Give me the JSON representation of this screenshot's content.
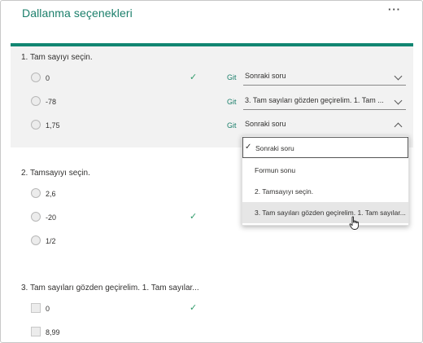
{
  "header": {
    "title": "Dallanma seçenekleri",
    "more": "···"
  },
  "git_label": "Git",
  "questions": [
    {
      "label": "1. Tam sayıyı seçin.",
      "options": [
        {
          "text": "0",
          "correct": true,
          "branch": "Sonraki soru"
        },
        {
          "text": "-78",
          "correct": false,
          "branch": "3. Tam sayıları gözden geçirelim. 1. Tam ..."
        },
        {
          "text": "1,75",
          "correct": false,
          "branch": "Sonraki soru"
        }
      ]
    },
    {
      "label": "2. Tamsayıyı seçin.",
      "options": [
        {
          "text": "2,6",
          "correct": false
        },
        {
          "text": "-20",
          "correct": true
        },
        {
          "text": "1/2",
          "correct": false
        }
      ]
    },
    {
      "label": "3. Tam sayıları gözden geçirelim. 1. Tam sayılar...",
      "options": [
        {
          "text": "0",
          "correct": true
        },
        {
          "text": "8,99",
          "correct": false
        }
      ]
    }
  ],
  "dropdown": {
    "items": [
      {
        "label": "Sonraki soru",
        "selected": true
      },
      {
        "label": "Formun sonu",
        "selected": false
      },
      {
        "label": "2. Tamsayıyı seçin.",
        "selected": false
      },
      {
        "label": "3. Tam sayıları gözden geçirelim. 1. Tam sayılar...",
        "selected": false
      }
    ],
    "check_mark": "✓"
  },
  "colors": {
    "accent": "#118672",
    "check": "#2f9b6a",
    "panel": "#f2f2f2"
  },
  "icons": {
    "check": "checkmark-icon",
    "more": "more-options-icon",
    "cursor": "hand-pointer-icon"
  }
}
